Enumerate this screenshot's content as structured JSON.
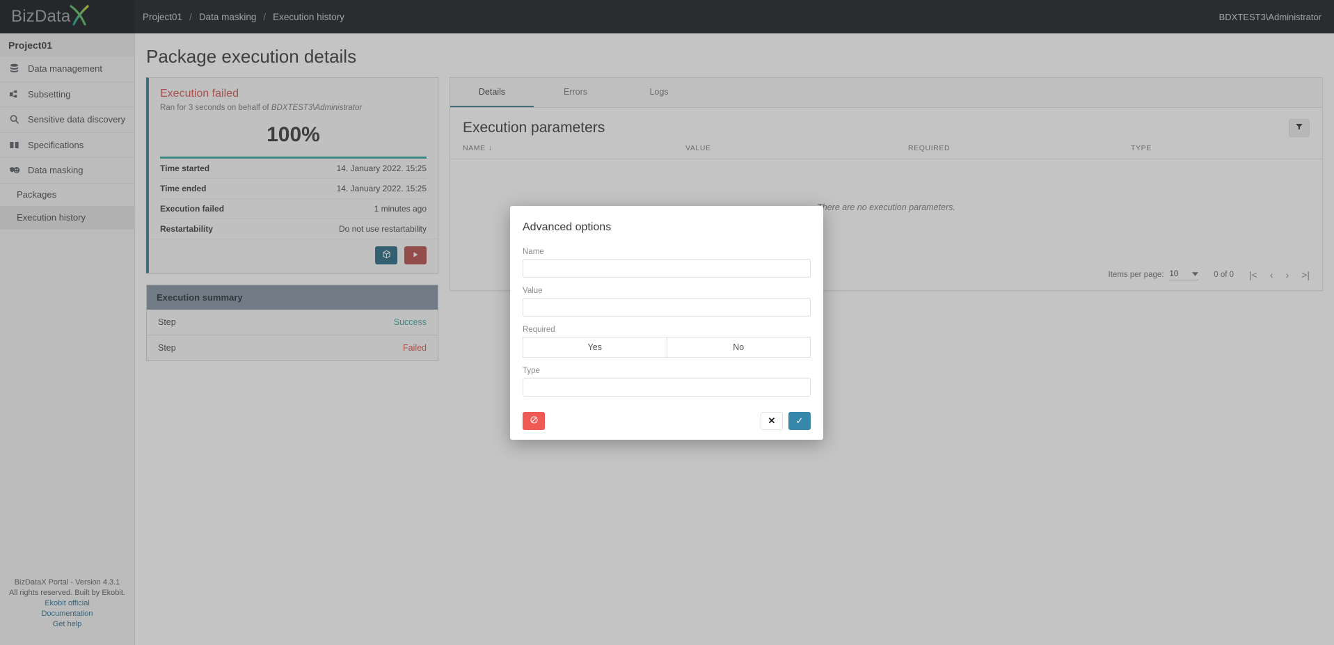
{
  "topbar": {
    "logo_text": "BizData",
    "logo_x": "X",
    "logo_icon": "bizdatax-logo",
    "breadcrumb": [
      "Project01",
      "Data masking",
      "Execution history"
    ],
    "separator": "/",
    "user": "BDXTEST3\\Administrator"
  },
  "sidebar": {
    "project": "Project01",
    "items": [
      {
        "label": "Data management",
        "icon": "database-icon"
      },
      {
        "label": "Subsetting",
        "icon": "subset-icon"
      },
      {
        "label": "Sensitive data discovery",
        "icon": "search-icon"
      },
      {
        "label": "Specifications",
        "icon": "book-icon"
      },
      {
        "label": "Data masking",
        "icon": "masks-icon"
      }
    ],
    "subitems": [
      {
        "label": "Packages",
        "active": false
      },
      {
        "label": "Execution history",
        "active": true
      }
    ],
    "footer": {
      "version": "BizDataX Portal - Version 4.3.1",
      "rights": "All rights reserved. Built by Ekobit.",
      "links": [
        "Ekobit official",
        "Documentation",
        "Get help"
      ]
    }
  },
  "page": {
    "title": "Package execution details"
  },
  "execution_card": {
    "status": "Execution failed",
    "subtitle_prefix": "Ran for 3 seconds on behalf of ",
    "subtitle_user": "BDXTEST3\\Administrator",
    "progress": "100%",
    "rows": [
      {
        "key": "Time started",
        "value": "14. January 2022. 15:25"
      },
      {
        "key": "Time ended",
        "value": "14. January 2022. 15:25"
      },
      {
        "key": "Execution failed",
        "value": "1 minutes ago"
      },
      {
        "key": "Restartability",
        "value": "Do not use restartability"
      }
    ],
    "actions": [
      {
        "name": "package-button",
        "icon": "package-icon"
      },
      {
        "name": "run-button",
        "icon": "play-icon"
      }
    ]
  },
  "execution_summary": {
    "title": "Execution summary",
    "rows": [
      {
        "step": "Step",
        "status": "Success"
      },
      {
        "step": "Step",
        "status": "Failed"
      }
    ]
  },
  "details_panel": {
    "tabs": [
      {
        "label": "Details",
        "active": true
      },
      {
        "label": "Errors",
        "active": false
      },
      {
        "label": "Logs",
        "active": false
      }
    ],
    "title": "Execution parameters",
    "filter_icon": "filter-icon",
    "columns": [
      "NAME",
      "VALUE",
      "REQUIRED",
      "TYPE"
    ],
    "sort_indicator": "↓",
    "empty_message": "There are no execution parameters.",
    "paginator": {
      "items_per_page_label": "Items per page:",
      "items_per_page_value": "10",
      "dropdown_icon": "chevron-down-icon",
      "range": "0 of 0",
      "first_icon": "|<",
      "prev_icon": "‹",
      "next_icon": "›",
      "last_icon": ">|"
    }
  },
  "modal": {
    "title": "Advanced options",
    "fields": [
      {
        "label": "Name",
        "value": "",
        "placeholder": ""
      },
      {
        "label": "Value",
        "value": "",
        "placeholder": ""
      },
      {
        "label": "Type",
        "value": "",
        "placeholder": ""
      }
    ],
    "required": {
      "label": "Required",
      "options": [
        "Yes",
        "No"
      ]
    },
    "buttons": {
      "clear": {
        "name": "clear-button",
        "icon": "ban-icon"
      },
      "cancel": {
        "name": "cancel-button",
        "icon": "close-icon",
        "glyph": "✕"
      },
      "confirm": {
        "name": "confirm-button",
        "icon": "check-icon",
        "glyph": "✓"
      }
    }
  },
  "colors": {
    "topbar": "#1c1f26",
    "accent_teal": "#3aa8a0",
    "accent_blue": "#3a7d8c",
    "danger": "#d9534f",
    "primary_button": "#3787ab",
    "summary_header": "#8596a4"
  }
}
